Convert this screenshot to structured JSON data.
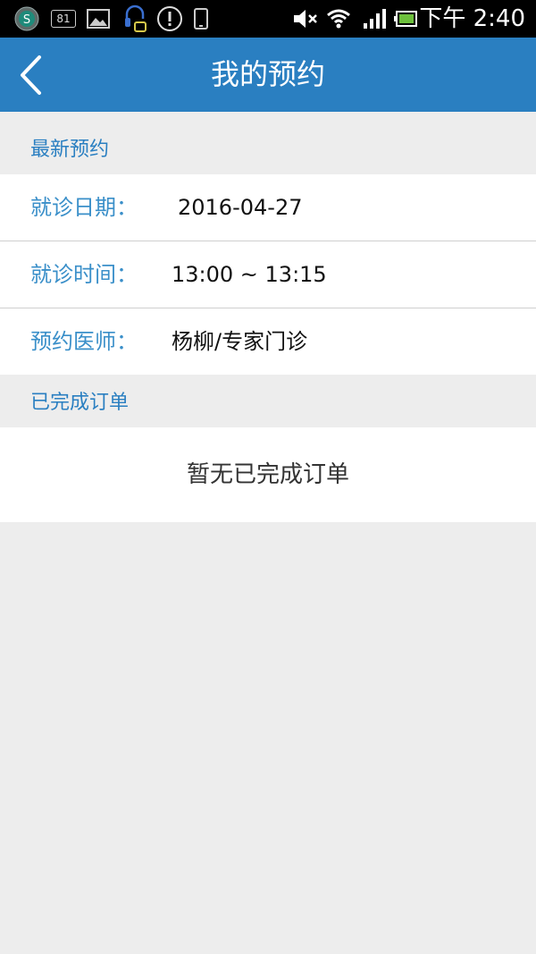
{
  "status_bar": {
    "notification_count": "81",
    "clock": "下午 2:40"
  },
  "header": {
    "title": "我的预约"
  },
  "latest": {
    "section_title": "最新预约",
    "date_label": "就诊日期：",
    "date_value": "2016-04-27",
    "time_label": "就诊时间：",
    "time_value": "13:00 ~ 13:15",
    "doctor_label": "预约医师：",
    "doctor_value": "杨柳/专家门诊"
  },
  "completed": {
    "section_title": "已完成订单",
    "empty_text": "暂无已完成订单"
  },
  "colors": {
    "header_bg": "#2a7fc1",
    "accent_text": "#2a7fc1",
    "page_bg": "#ededed"
  }
}
